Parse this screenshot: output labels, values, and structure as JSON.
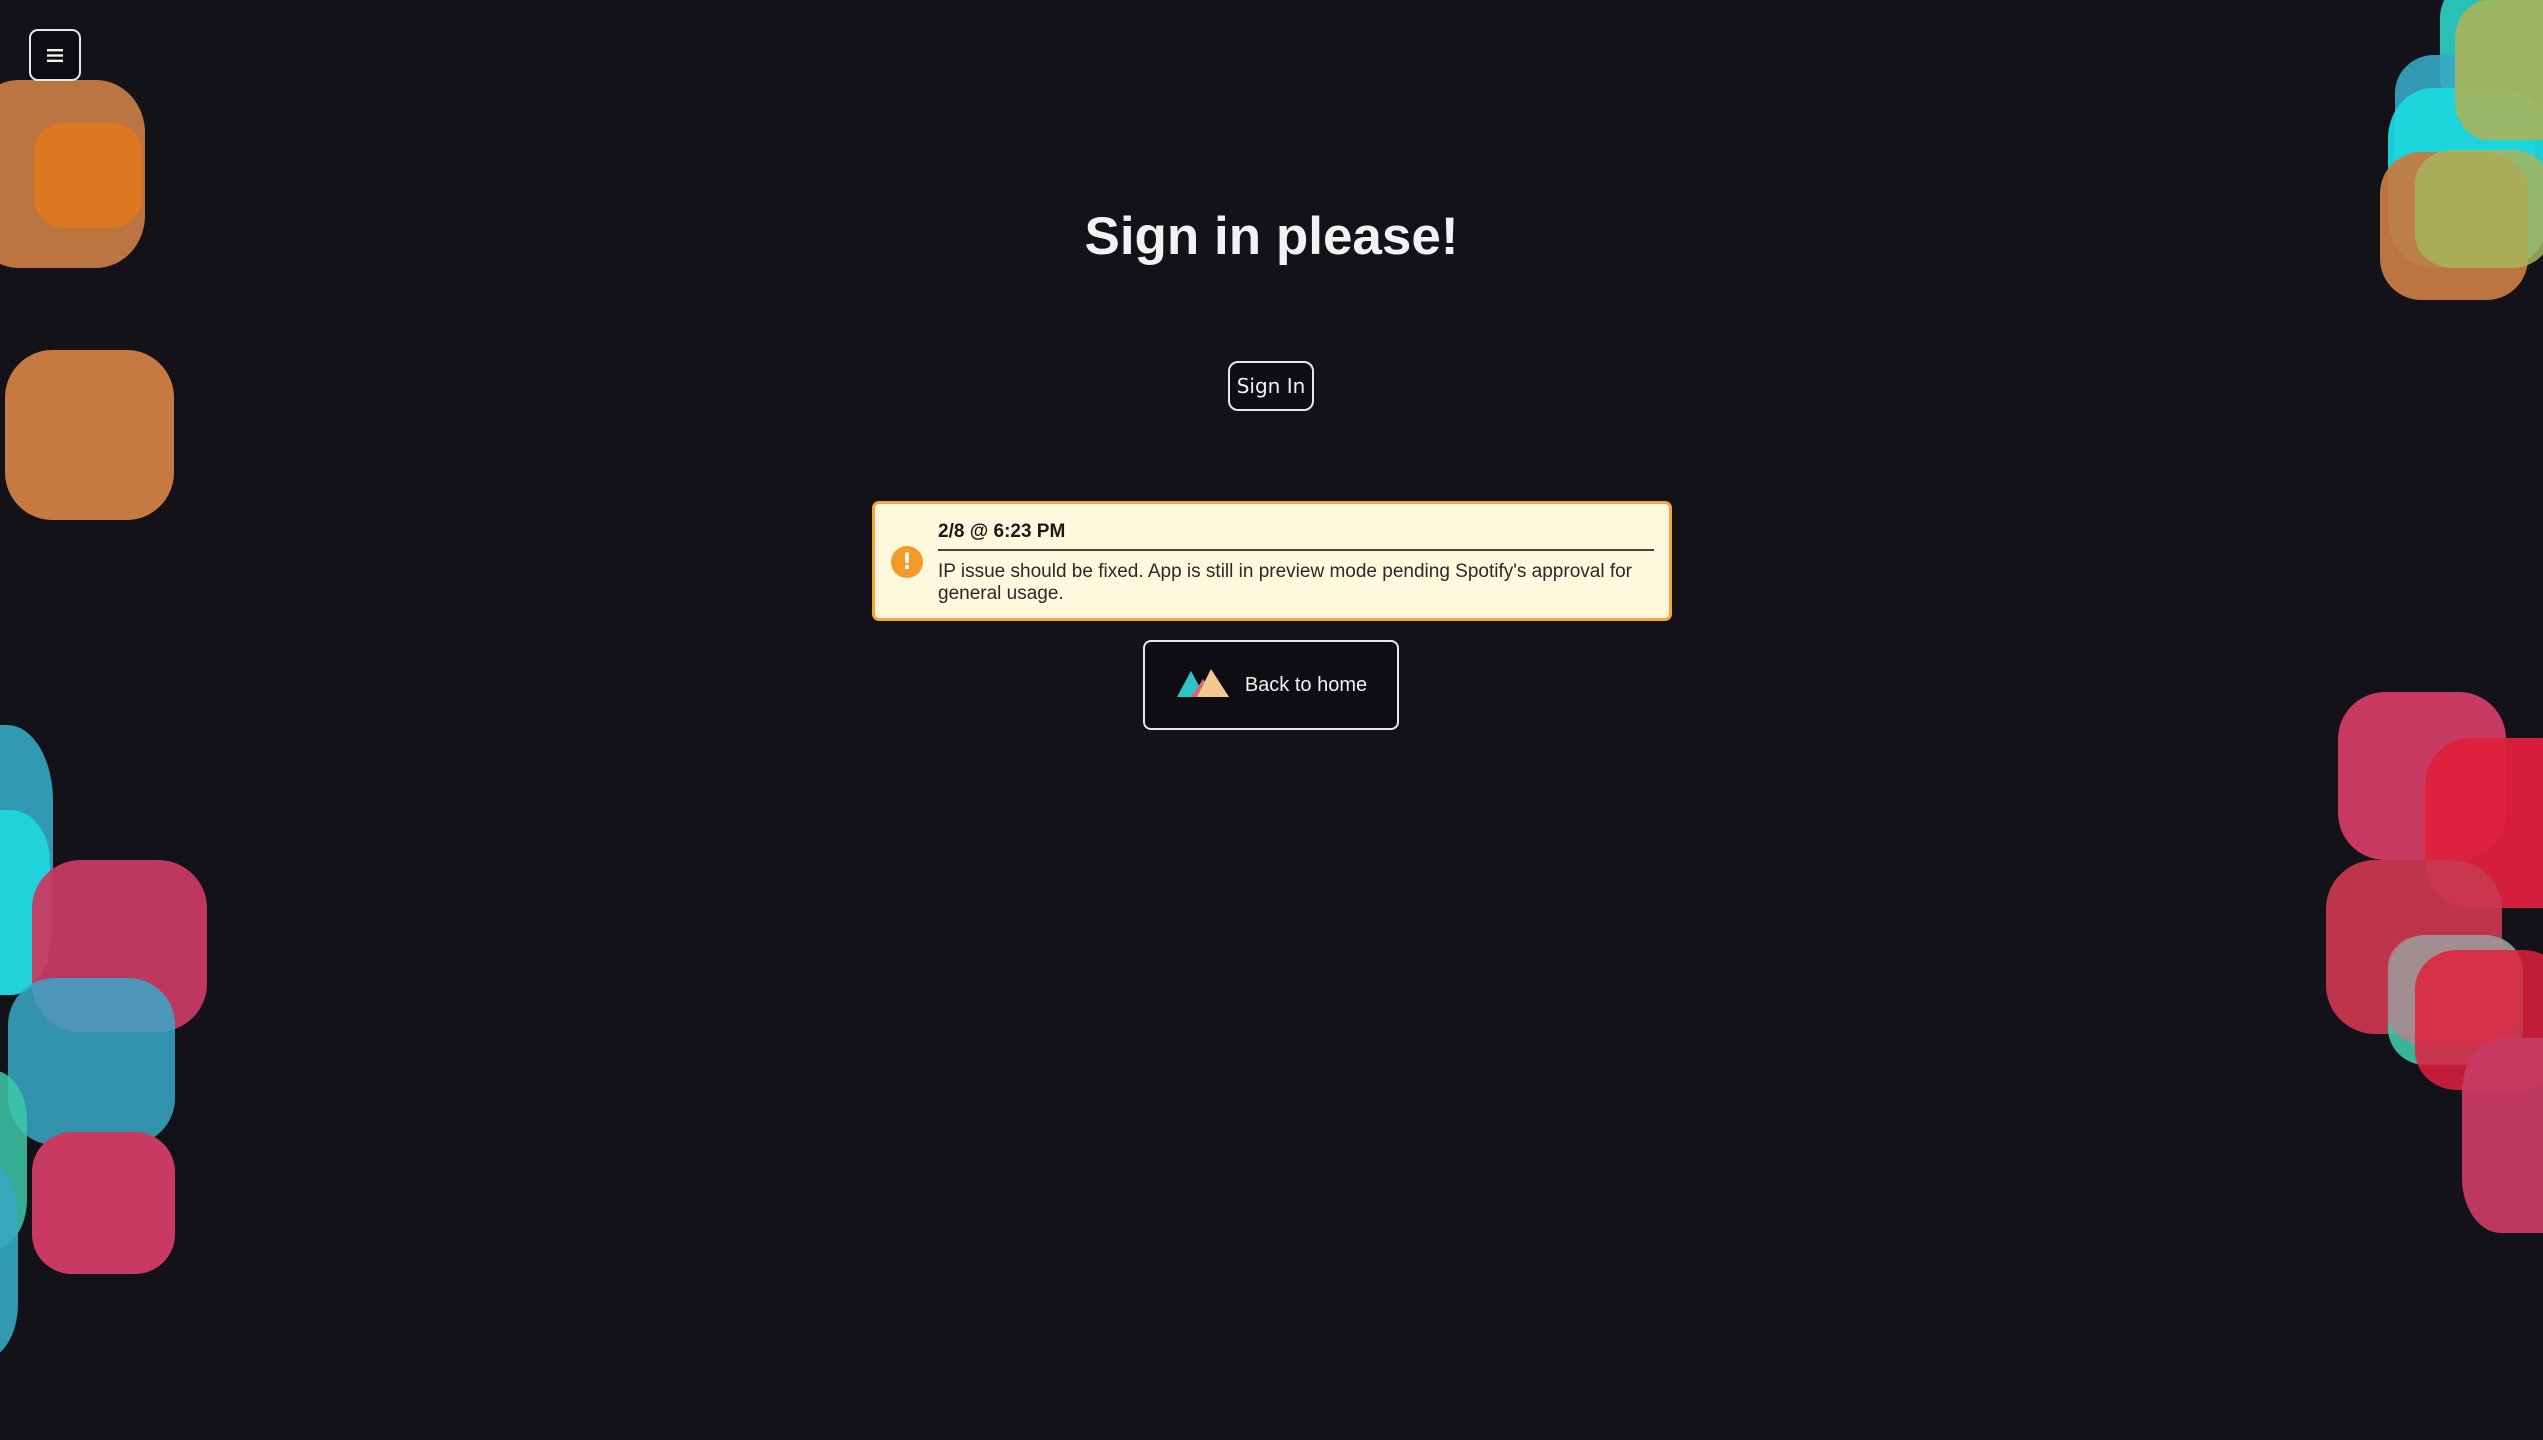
{
  "menu": {
    "icon": "hamburger-icon"
  },
  "header": {
    "title": "Sign in please!"
  },
  "auth": {
    "sign_in_label": "Sign In"
  },
  "notice": {
    "icon": "exclamation-icon",
    "date": "2/8 @ 6:23 PM",
    "message": "IP issue should be fixed. App is still in preview mode pending Spotify's approval for general usage."
  },
  "home": {
    "icon": "mountain-logo-icon",
    "label": "Back to home"
  },
  "colors": {
    "background": "#121218",
    "notice_bg": "#fef8dc",
    "notice_border": "#f7a63a",
    "orange_tile": "#c67a42",
    "cyan_tile": "#1dd8e0",
    "pink_tile": "#c83a62",
    "red_tile": "#e0203e"
  }
}
